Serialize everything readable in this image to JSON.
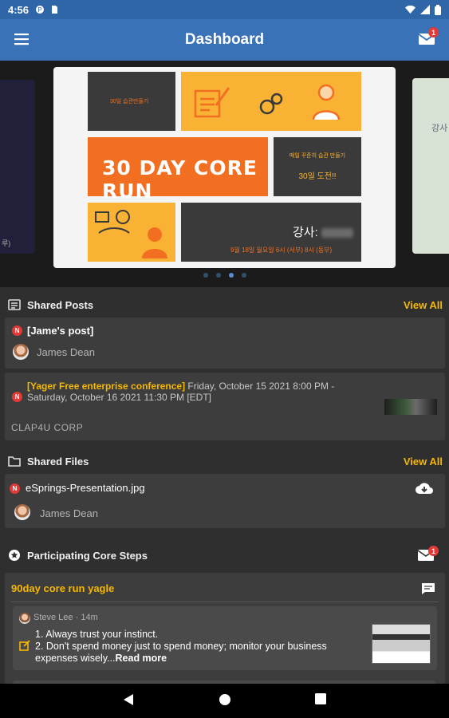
{
  "status_bar": {
    "time": "4:56"
  },
  "app_bar": {
    "title": "Dashboard",
    "mail_badge": "1"
  },
  "carousel": {
    "active_slide": 3,
    "total_slides": 4,
    "slide": {
      "title": "30 DAY CORE RUN",
      "small_label": "30일 습관만들기",
      "korean_line1": "매일 꾸준히 습관 만들기",
      "korean_line2": "30일 도전!!",
      "instructor_label": "강사:",
      "schedule": "9월 18일 월요일 6시 (서부) 8시 (동부)"
    },
    "left_peek_text": "루)",
    "right_peek_text": "강사"
  },
  "shared_posts": {
    "title": "Shared Posts",
    "view_all": "View All",
    "posts": [
      {
        "title": "[Jame's post]",
        "author": "James Dean"
      },
      {
        "event_title": "[Yager Free enterprise conference]",
        "event_time": " Friday, October 15 2021 8:00 PM - Saturday, October 16 2021 11:30 PM [EDT]",
        "company": "CLAP4U CORP"
      }
    ]
  },
  "shared_files": {
    "title": "Shared Files",
    "view_all": "View All",
    "files": [
      {
        "name": "eSprings-Presentation.jpg",
        "author": "James Dean"
      }
    ]
  },
  "core_steps": {
    "title": "Participating Core Steps",
    "mail_badge": "1",
    "group": {
      "name": "90day core run yagle",
      "post": {
        "author": "Steve Lee",
        "time": "14m",
        "line1": "1. Always trust your instinct.",
        "line2": "2. Don't spend money just to spend money; monitor your business expenses wisely...",
        "read_more": "Read more"
      }
    }
  },
  "badge_letter": "N",
  "colors": {
    "accent": "#f5b800",
    "app_bar": "#3a72b8",
    "badge": "#e53935"
  }
}
